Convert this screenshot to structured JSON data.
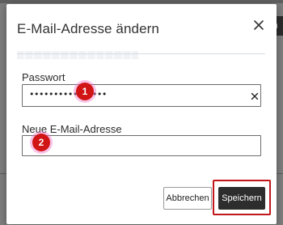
{
  "background": {
    "right_button_glyph": "n"
  },
  "dialog": {
    "title": "E-Mail-Adresse ändern",
    "close_icon": "close-icon",
    "password": {
      "label": "Passwort",
      "value": "••••••••••••••••",
      "clear_icon": "clear-x-icon"
    },
    "email": {
      "label": "Neue E-Mail-Adresse",
      "value": ""
    },
    "buttons": {
      "cancel": "Abbrechen",
      "save": "Speichern"
    }
  },
  "markers": [
    "1",
    "2"
  ],
  "colors": {
    "marker_red": "#d11414",
    "highlight_frame": "#c2171b",
    "primary_button": "#2d2d2d"
  }
}
